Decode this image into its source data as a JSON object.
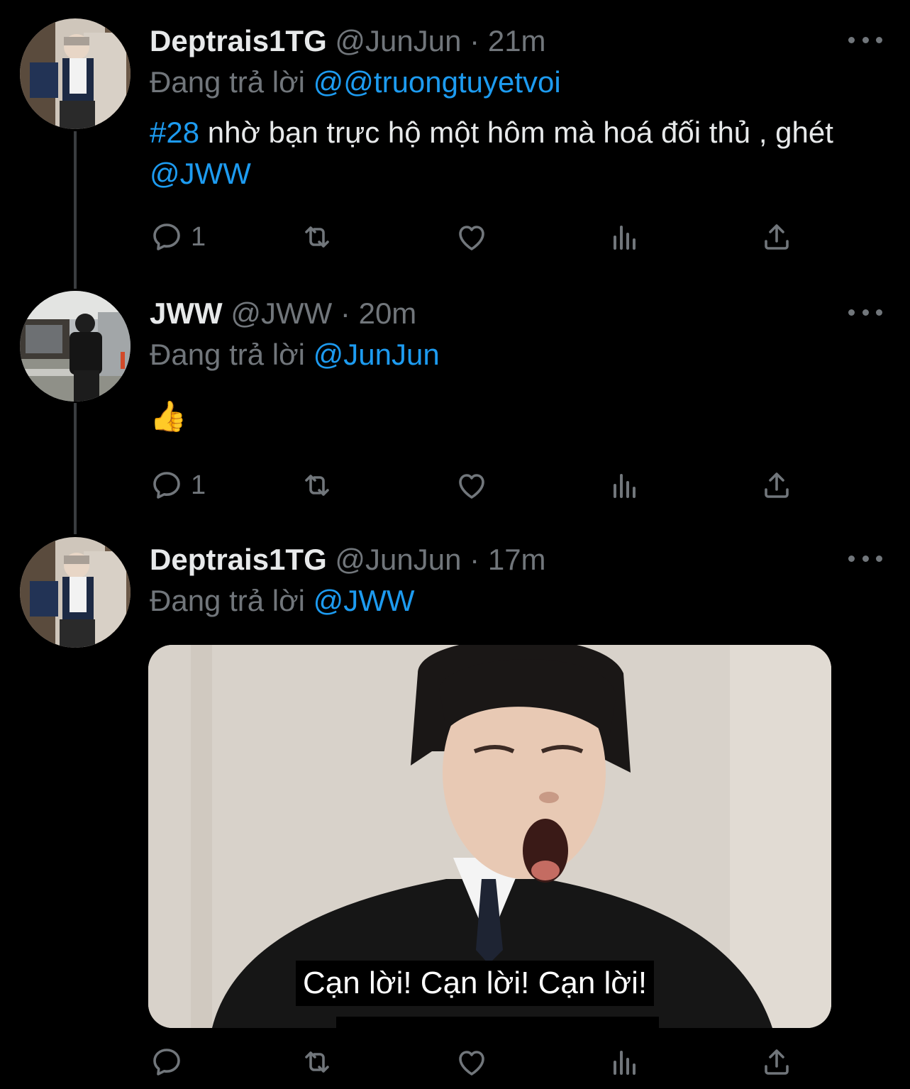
{
  "tweets": [
    {
      "name": "Deptrais1TG",
      "handle": "@JunJun",
      "time": "21m",
      "replying_prefix": "Đang trả lời",
      "replying_to": "@@truongtuyetvoi",
      "hashtag": "#28",
      "text": " nhờ bạn trực hộ một hôm mà hoá đối thủ , ghét ",
      "mention": "@JWW",
      "reply_count": "1"
    },
    {
      "name": "JWW",
      "handle": "@JWW",
      "time": "20m",
      "replying_prefix": "Đang trả lời",
      "replying_to": "@JunJun",
      "text": "👍",
      "reply_count": "1"
    },
    {
      "name": "Deptrais1TG",
      "handle": "@JunJun",
      "time": "17m",
      "replying_prefix": "Đang trả lời",
      "replying_to": "@JWW",
      "media_caption": "Cạn lời! Cạn lời! Cạn lời!",
      "reply_count": ""
    }
  ],
  "separator": "·",
  "icons": {
    "reply": "reply-icon",
    "retweet": "retweet-icon",
    "like": "heart-icon",
    "views": "views-icon",
    "share": "share-icon",
    "more": "more-icon"
  },
  "colors": {
    "background": "#000000",
    "text": "#e7e9ea",
    "muted": "#71767b",
    "link": "#1d9bf0",
    "thread_line": "#3a3d40"
  }
}
